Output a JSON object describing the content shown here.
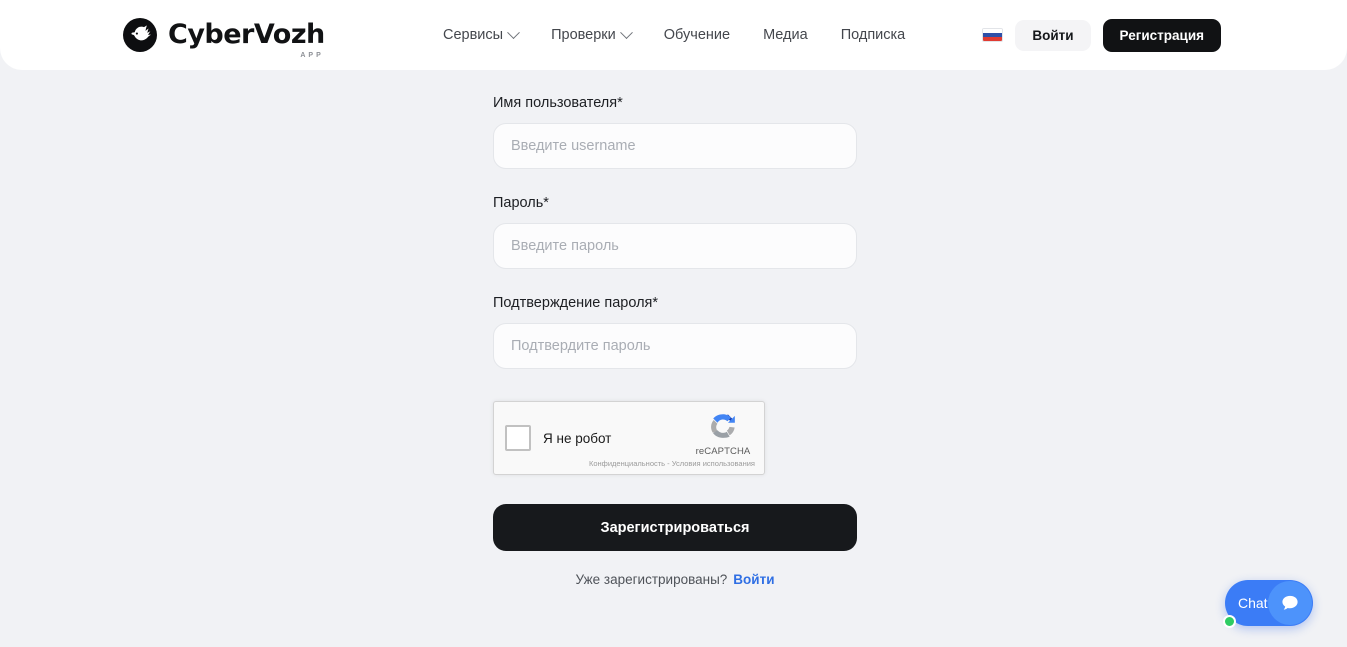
{
  "header": {
    "brand": {
      "name": "CyberVozh",
      "subtitle": "APP",
      "logo_icon": "eagle-head-icon"
    },
    "nav": [
      {
        "label": "Сервисы",
        "has_dropdown": true
      },
      {
        "label": "Проверки",
        "has_dropdown": true
      },
      {
        "label": "Обучение",
        "has_dropdown": false
      },
      {
        "label": "Медиа",
        "has_dropdown": false
      },
      {
        "label": "Подписка",
        "has_dropdown": false
      }
    ],
    "language_flag": "russia-flag-icon",
    "login_label": "Войти",
    "register_label": "Регистрация"
  },
  "form": {
    "username": {
      "label": "Имя пользователя*",
      "placeholder": "Введите username",
      "value": ""
    },
    "password": {
      "label": "Пароль*",
      "placeholder": "Введите пароль",
      "value": ""
    },
    "password_confirm": {
      "label": "Подтверждение пароля*",
      "placeholder": "Подтвердите пароль",
      "value": ""
    },
    "recaptcha": {
      "checkbox_label": "Я не робот",
      "brand": "reCAPTCHA",
      "terms": "Конфиденциальность - Условия использования",
      "checked": false,
      "logo_icon": "recaptcha-icon"
    },
    "submit_label": "Зарегистрироваться",
    "login_hint_text": "Уже зарегистрированы?",
    "login_hint_link": "Войти"
  },
  "chat_widget": {
    "label": "Chat",
    "bubble_icon": "speech-bubble-icon",
    "status": "online"
  },
  "colors": {
    "page_background": "#f1f2f5",
    "header_background": "#ffffff",
    "accent_dark": "#111214",
    "link_blue": "#2f6fe4",
    "chat_blue": "#3b7cf6",
    "status_green": "#2ecc63"
  }
}
